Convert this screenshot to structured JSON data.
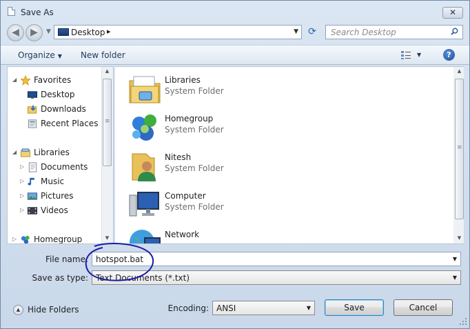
{
  "window": {
    "title": "Save As",
    "close_glyph": "✕"
  },
  "nav": {
    "back_glyph": "◀",
    "forward_glyph": "▶",
    "address": "Desktop",
    "address_chevron": "▸",
    "refresh_glyph": "⟳",
    "search_placeholder": "Search Desktop"
  },
  "toolbar": {
    "organize_label": "Organize",
    "new_folder_label": "New folder",
    "help_glyph": "?"
  },
  "sidebar": {
    "items": [
      {
        "label": "Favorites",
        "icon": "star-icon"
      },
      {
        "label": "Desktop",
        "icon": "desktop-icon"
      },
      {
        "label": "Downloads",
        "icon": "downloads-icon"
      },
      {
        "label": "Recent Places",
        "icon": "recent-places-icon"
      },
      {
        "label": "Libraries",
        "icon": "libraries-icon"
      },
      {
        "label": "Documents",
        "icon": "documents-icon"
      },
      {
        "label": "Music",
        "icon": "music-icon"
      },
      {
        "label": "Pictures",
        "icon": "pictures-icon"
      },
      {
        "label": "Videos",
        "icon": "videos-icon"
      },
      {
        "label": "Homegroup",
        "icon": "homegroup-icon"
      }
    ]
  },
  "files": [
    {
      "name": "Libraries",
      "type": "System Folder",
      "icon": "libraries-folder-icon"
    },
    {
      "name": "Homegroup",
      "type": "System Folder",
      "icon": "homegroup-icon"
    },
    {
      "name": "Nitesh",
      "type": "System Folder",
      "icon": "user-folder-icon"
    },
    {
      "name": "Computer",
      "type": "System Folder",
      "icon": "computer-icon"
    },
    {
      "name": "Network",
      "type": "",
      "icon": "network-icon"
    }
  ],
  "form": {
    "file_name_label": "File name:",
    "file_name_value": "hotspot.bat",
    "save_as_type_label": "Save as type:",
    "save_as_type_value": "Text Documents (*.txt)",
    "encoding_label": "Encoding:",
    "encoding_value": "ANSI",
    "hide_folders_label": "Hide Folders",
    "save_label": "Save",
    "cancel_label": "Cancel"
  },
  "colors": {
    "annotation": "#1a1aa8",
    "chrome": "#dbe6f3",
    "toolbar_text": "#1e395b"
  }
}
